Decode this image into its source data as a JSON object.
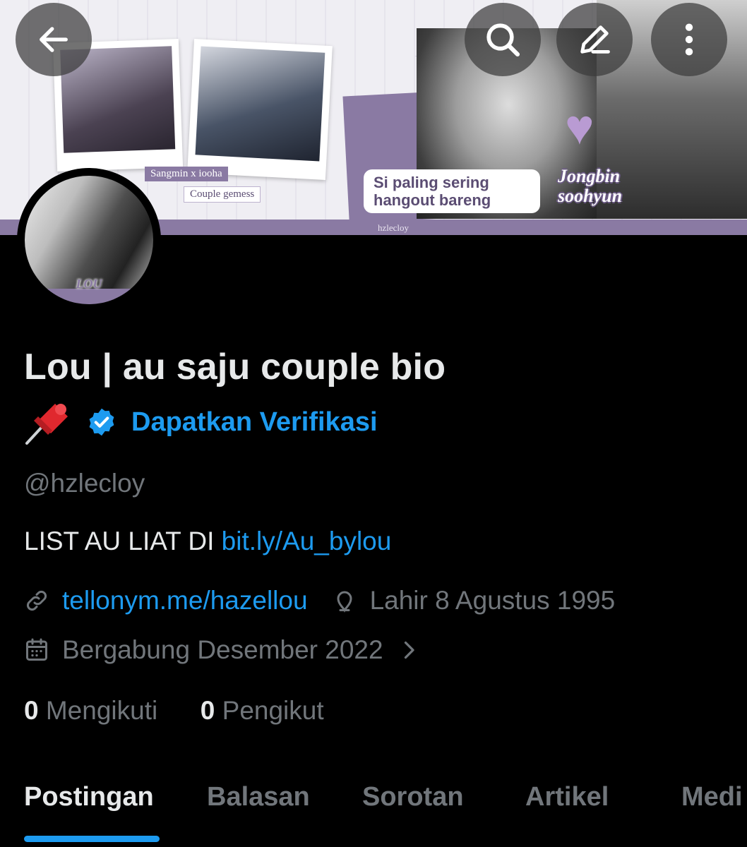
{
  "banner": {
    "tag_a": "Sangmin x iooha",
    "tag_b": "Couple gemess",
    "caption_c": "Si paling sering hangout  bareng",
    "caption_d_line1": "Jongbin",
    "caption_d_line2": "soohyun",
    "watermark": "hzlecloy"
  },
  "avatar": {
    "text": "LOU"
  },
  "profile": {
    "name": "Lou | au saju couple bio",
    "verify_label": "Dapatkan Verifikasi",
    "handle": "@hzlecloy",
    "bio_text": "LIST AU LIAT DI ",
    "bio_link": "bit.ly/Au_bylou",
    "website": "tellonym.me/hazellou",
    "birth": "Lahir 8 Agustus 1995",
    "joined": "Bergabung Desember 2022",
    "following_count": "0",
    "following_label": "Mengikuti",
    "followers_count": "0",
    "followers_label": "Pengikut"
  },
  "tabs": [
    "Postingan",
    "Balasan",
    "Sorotan",
    "Artikel",
    "Medi"
  ],
  "colors": {
    "accent": "#1d9bf0",
    "muted": "#71767b",
    "text": "#e7e9ea",
    "background": "#000000",
    "banner_purple": "#8a7aa3"
  },
  "icons": {
    "back": "arrow-left-icon",
    "search": "search-icon",
    "edit": "edit-icon",
    "more": "more-vertical-icon",
    "pin": "pushpin-icon",
    "verified": "verified-badge-icon",
    "link": "link-icon",
    "location": "location-icon",
    "calendar": "calendar-icon",
    "chevron": "chevron-right-icon"
  }
}
